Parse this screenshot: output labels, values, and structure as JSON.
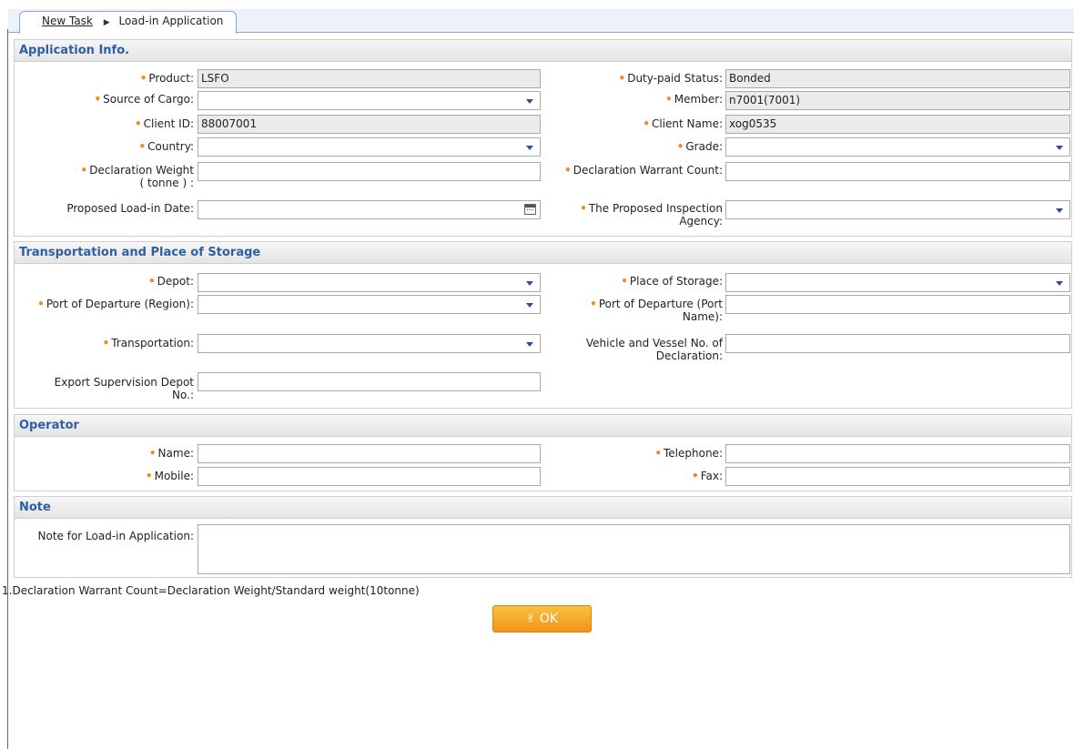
{
  "breadcrumb": {
    "parent": "New Task",
    "current": "Load-in Application"
  },
  "sections": {
    "application": {
      "title": "Application Info.",
      "product": {
        "label": "Product:",
        "value": "LSFO"
      },
      "duty_status": {
        "label": "Duty-paid Status:",
        "value": "Bonded"
      },
      "source_of_cargo": {
        "label": "Source of Cargo:",
        "value": ""
      },
      "member": {
        "label": "Member:",
        "value": "n7001(7001)"
      },
      "client_id": {
        "label": "Client ID:",
        "value": "88007001"
      },
      "client_name": {
        "label": "Client Name:",
        "value": "xog0535"
      },
      "country": {
        "label": "Country:",
        "value": ""
      },
      "grade": {
        "label": "Grade:",
        "value": ""
      },
      "decl_weight": {
        "label_line1": "Declaration Weight",
        "label_line2": "( tonne ) :",
        "value": ""
      },
      "decl_warrant": {
        "label": "Declaration Warrant Count:",
        "value": ""
      },
      "load_in_date": {
        "label": "Proposed Load-in Date:",
        "value": ""
      },
      "inspection_agency": {
        "label_line1": "The Proposed Inspection",
        "label_line2": "Agency:",
        "value": ""
      }
    },
    "transport": {
      "title": "Transportation and Place of Storage",
      "depot": {
        "label": "Depot:",
        "value": ""
      },
      "place_of_storage": {
        "label": "Place of Storage:",
        "value": ""
      },
      "port_region": {
        "label": "Port of Departure (Region):",
        "value": ""
      },
      "port_name": {
        "label_line1": "Port of Departure (Port",
        "label_line2": "Name):",
        "value": ""
      },
      "transportation": {
        "label": "Transportation:",
        "value": ""
      },
      "vehicle_vessel": {
        "label_line1": "Vehicle and Vessel No. of",
        "label_line2": "Declaration:",
        "value": ""
      },
      "export_depot": {
        "label_line1": "Export Supervision Depot",
        "label_line2": "No.:",
        "value": ""
      }
    },
    "operator": {
      "title": "Operator",
      "name": {
        "label": "Name:",
        "value": ""
      },
      "telephone": {
        "label": "Telephone:",
        "value": ""
      },
      "mobile": {
        "label": "Mobile:",
        "value": ""
      },
      "fax": {
        "label": "Fax:",
        "value": ""
      }
    },
    "note": {
      "title": "Note",
      "note": {
        "label": "Note for Load-in Application:",
        "value": ""
      }
    }
  },
  "footnote": "1.Declaration Warrant Count=Declaration Weight/Standard weight(10tonne)",
  "ok_button": {
    "label": "OK",
    "icon": "hand-pointer-icon"
  },
  "colors": {
    "required_marker": "#f08c1e",
    "section_title": "#2e5fa3",
    "button": "#f5a623"
  }
}
